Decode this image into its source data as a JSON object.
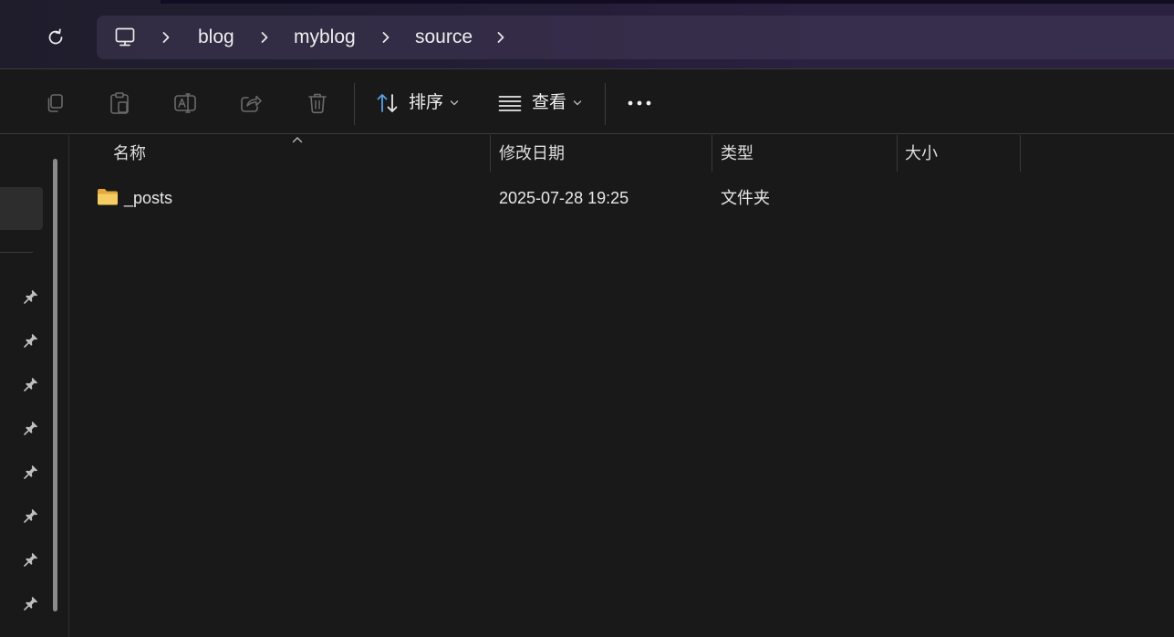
{
  "address_bar": {
    "root_icon": "computer-icon",
    "breadcrumbs": [
      "blog",
      "myblog",
      "source"
    ]
  },
  "command_bar": {
    "icons": [
      "copy-icon",
      "paste-icon",
      "rename-icon",
      "share-icon",
      "delete-icon"
    ],
    "sort_label": "排序",
    "view_label": "查看",
    "more_icon": "more-icon"
  },
  "columns": {
    "name": "名称",
    "modified": "修改日期",
    "type": "类型",
    "size": "大小"
  },
  "files": [
    {
      "name": "_posts",
      "modified": "2025-07-28 19:25",
      "type": "文件夹",
      "size": ""
    }
  ],
  "sidebar": {
    "pinned_count": 8
  },
  "colors": {
    "folder": "#f2c35a",
    "accent": "#5aa0e6"
  }
}
